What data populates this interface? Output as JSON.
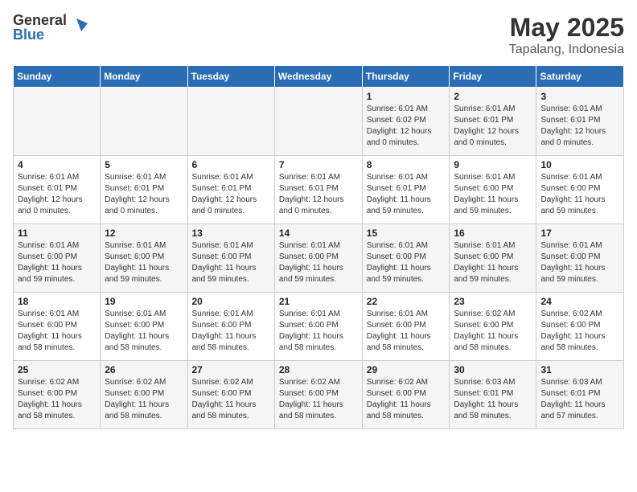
{
  "header": {
    "logo_general": "General",
    "logo_blue": "Blue",
    "month": "May 2025",
    "location": "Tapalang, Indonesia"
  },
  "weekdays": [
    "Sunday",
    "Monday",
    "Tuesday",
    "Wednesday",
    "Thursday",
    "Friday",
    "Saturday"
  ],
  "weeks": [
    [
      {
        "day": "",
        "info": ""
      },
      {
        "day": "",
        "info": ""
      },
      {
        "day": "",
        "info": ""
      },
      {
        "day": "",
        "info": ""
      },
      {
        "day": "1",
        "info": "Sunrise: 6:01 AM\nSunset: 6:02 PM\nDaylight: 12 hours\nand 0 minutes."
      },
      {
        "day": "2",
        "info": "Sunrise: 6:01 AM\nSunset: 6:01 PM\nDaylight: 12 hours\nand 0 minutes."
      },
      {
        "day": "3",
        "info": "Sunrise: 6:01 AM\nSunset: 6:01 PM\nDaylight: 12 hours\nand 0 minutes."
      }
    ],
    [
      {
        "day": "4",
        "info": "Sunrise: 6:01 AM\nSunset: 6:01 PM\nDaylight: 12 hours\nand 0 minutes."
      },
      {
        "day": "5",
        "info": "Sunrise: 6:01 AM\nSunset: 6:01 PM\nDaylight: 12 hours\nand 0 minutes."
      },
      {
        "day": "6",
        "info": "Sunrise: 6:01 AM\nSunset: 6:01 PM\nDaylight: 12 hours\nand 0 minutes."
      },
      {
        "day": "7",
        "info": "Sunrise: 6:01 AM\nSunset: 6:01 PM\nDaylight: 12 hours\nand 0 minutes."
      },
      {
        "day": "8",
        "info": "Sunrise: 6:01 AM\nSunset: 6:01 PM\nDaylight: 11 hours\nand 59 minutes."
      },
      {
        "day": "9",
        "info": "Sunrise: 6:01 AM\nSunset: 6:00 PM\nDaylight: 11 hours\nand 59 minutes."
      },
      {
        "day": "10",
        "info": "Sunrise: 6:01 AM\nSunset: 6:00 PM\nDaylight: 11 hours\nand 59 minutes."
      }
    ],
    [
      {
        "day": "11",
        "info": "Sunrise: 6:01 AM\nSunset: 6:00 PM\nDaylight: 11 hours\nand 59 minutes."
      },
      {
        "day": "12",
        "info": "Sunrise: 6:01 AM\nSunset: 6:00 PM\nDaylight: 11 hours\nand 59 minutes."
      },
      {
        "day": "13",
        "info": "Sunrise: 6:01 AM\nSunset: 6:00 PM\nDaylight: 11 hours\nand 59 minutes."
      },
      {
        "day": "14",
        "info": "Sunrise: 6:01 AM\nSunset: 6:00 PM\nDaylight: 11 hours\nand 59 minutes."
      },
      {
        "day": "15",
        "info": "Sunrise: 6:01 AM\nSunset: 6:00 PM\nDaylight: 11 hours\nand 59 minutes."
      },
      {
        "day": "16",
        "info": "Sunrise: 6:01 AM\nSunset: 6:00 PM\nDaylight: 11 hours\nand 59 minutes."
      },
      {
        "day": "17",
        "info": "Sunrise: 6:01 AM\nSunset: 6:00 PM\nDaylight: 11 hours\nand 59 minutes."
      }
    ],
    [
      {
        "day": "18",
        "info": "Sunrise: 6:01 AM\nSunset: 6:00 PM\nDaylight: 11 hours\nand 58 minutes."
      },
      {
        "day": "19",
        "info": "Sunrise: 6:01 AM\nSunset: 6:00 PM\nDaylight: 11 hours\nand 58 minutes."
      },
      {
        "day": "20",
        "info": "Sunrise: 6:01 AM\nSunset: 6:00 PM\nDaylight: 11 hours\nand 58 minutes."
      },
      {
        "day": "21",
        "info": "Sunrise: 6:01 AM\nSunset: 6:00 PM\nDaylight: 11 hours\nand 58 minutes."
      },
      {
        "day": "22",
        "info": "Sunrise: 6:01 AM\nSunset: 6:00 PM\nDaylight: 11 hours\nand 58 minutes."
      },
      {
        "day": "23",
        "info": "Sunrise: 6:02 AM\nSunset: 6:00 PM\nDaylight: 11 hours\nand 58 minutes."
      },
      {
        "day": "24",
        "info": "Sunrise: 6:02 AM\nSunset: 6:00 PM\nDaylight: 11 hours\nand 58 minutes."
      }
    ],
    [
      {
        "day": "25",
        "info": "Sunrise: 6:02 AM\nSunset: 6:00 PM\nDaylight: 11 hours\nand 58 minutes."
      },
      {
        "day": "26",
        "info": "Sunrise: 6:02 AM\nSunset: 6:00 PM\nDaylight: 11 hours\nand 58 minutes."
      },
      {
        "day": "27",
        "info": "Sunrise: 6:02 AM\nSunset: 6:00 PM\nDaylight: 11 hours\nand 58 minutes."
      },
      {
        "day": "28",
        "info": "Sunrise: 6:02 AM\nSunset: 6:00 PM\nDaylight: 11 hours\nand 58 minutes."
      },
      {
        "day": "29",
        "info": "Sunrise: 6:02 AM\nSunset: 6:00 PM\nDaylight: 11 hours\nand 58 minutes."
      },
      {
        "day": "30",
        "info": "Sunrise: 6:03 AM\nSunset: 6:01 PM\nDaylight: 11 hours\nand 58 minutes."
      },
      {
        "day": "31",
        "info": "Sunrise: 6:03 AM\nSunset: 6:01 PM\nDaylight: 11 hours\nand 57 minutes."
      }
    ]
  ]
}
